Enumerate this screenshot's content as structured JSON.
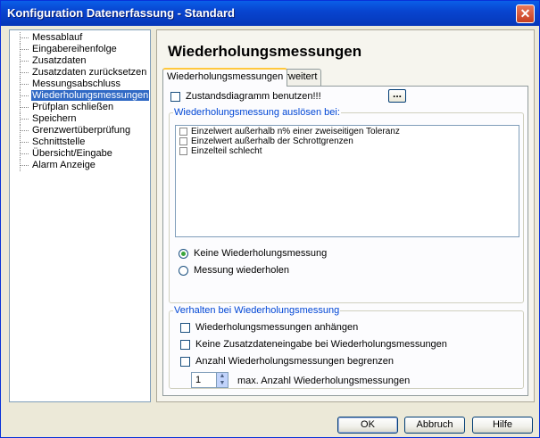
{
  "window": {
    "title": "Konfiguration Datenerfassung - Standard",
    "close_glyph": "✕"
  },
  "nav": {
    "items": [
      {
        "label": "Messablauf"
      },
      {
        "label": "Eingabereihenfolge"
      },
      {
        "label": "Zusatzdaten"
      },
      {
        "label": "Zusatzdaten zurücksetzen"
      },
      {
        "label": "Messungsabschluss"
      },
      {
        "label": "Wiederholungsmessungen",
        "selected": true
      },
      {
        "label": "Prüfplan schließen"
      },
      {
        "label": "Speichern"
      },
      {
        "label": "Grenzwertüberprüfung"
      },
      {
        "label": "Schnittstelle"
      },
      {
        "label": "Übersicht/Eingabe"
      },
      {
        "label": "Alarm Anzeige"
      }
    ]
  },
  "panel": {
    "title": "Wiederholungsmessungen",
    "tabs": [
      {
        "label": "Wiederholungsmessungen",
        "active": true
      },
      {
        "label": "Erweitert",
        "active": false
      }
    ],
    "zustand_checkbox": {
      "label": "Zustandsdiagramm benutzen!!!",
      "checked": false
    },
    "ellipsis_label": "...",
    "trigger_group": {
      "legend": "Wiederholungsmessung auslösen bei:",
      "items": [
        {
          "label": "Einzelwert außerhalb n% einer zweiseitigen Toleranz",
          "checked": false
        },
        {
          "label": "Einzelwert außerhalb der Schrottgrenzen",
          "checked": false
        },
        {
          "label": "Einzelteil schlecht",
          "checked": false
        }
      ]
    },
    "radios": [
      {
        "label": "Keine Wiederholungsmessung",
        "checked": true
      },
      {
        "label": "Messung wiederholen",
        "checked": false
      }
    ],
    "behavior_group": {
      "legend": "Verhalten bei Wiederholungsmessung",
      "checkboxes": [
        {
          "label": "Wiederholungsmessungen anhängen",
          "checked": false
        },
        {
          "label": "Keine Zusatzdateneingabe bei Wiederholungsmessungen",
          "checked": false
        },
        {
          "label": "Anzahl Wiederholungsmessungen begrenzen",
          "checked": false
        }
      ],
      "spinner_value": "1",
      "spinner_label": "max. Anzahl Wiederholungsmessungen"
    }
  },
  "buttons": {
    "ok": "OK",
    "cancel": "Abbruch",
    "help": "Hilfe"
  }
}
